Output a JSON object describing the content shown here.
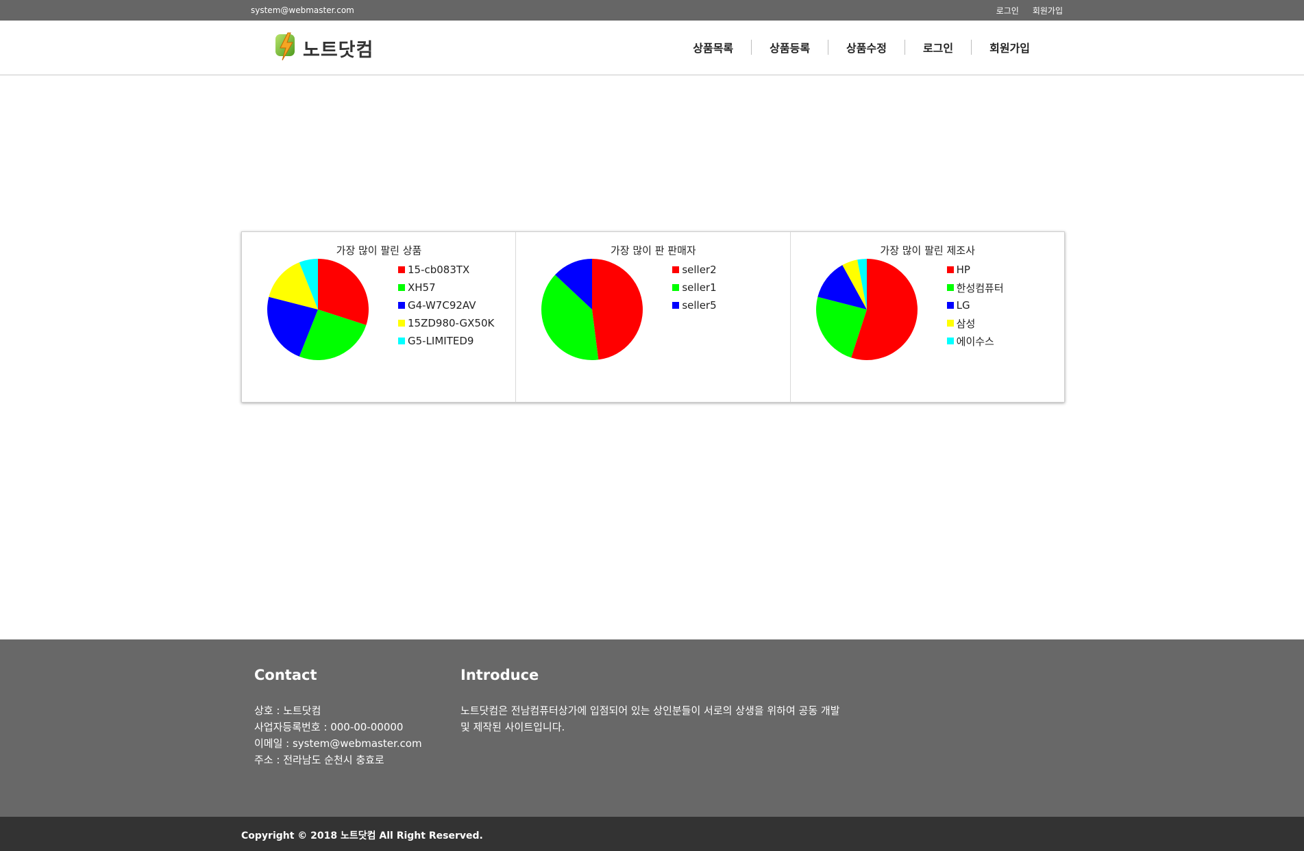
{
  "topbar": {
    "email": "system@webmaster.com",
    "login_label": "로그인",
    "signup_label": "회원가입"
  },
  "header": {
    "logo_text": "노트닷컴",
    "nav": [
      {
        "label": "상품목록"
      },
      {
        "label": "상품등록"
      },
      {
        "label": "상품수정"
      },
      {
        "label": "로그인"
      },
      {
        "label": "회원가입"
      }
    ]
  },
  "chart_data": [
    {
      "type": "pie",
      "title": "가장 많이 팔린 상품",
      "slices": [
        {
          "label": "15-cb083TX",
          "value": 30,
          "color": "#ff0000"
        },
        {
          "label": "XH57",
          "value": 26,
          "color": "#00ff00"
        },
        {
          "label": "G4-W7C92AV",
          "value": 23,
          "color": "#0000ff"
        },
        {
          "label": "15ZD980-GX50K",
          "value": 15,
          "color": "#ffff00"
        },
        {
          "label": "G5-LIMITED9",
          "value": 6,
          "color": "#00ffff"
        }
      ]
    },
    {
      "type": "pie",
      "title": "가장 많이 판 판매자",
      "slices": [
        {
          "label": "seller2",
          "value": 48,
          "color": "#ff0000"
        },
        {
          "label": "seller1",
          "value": 39,
          "color": "#00ff00"
        },
        {
          "label": "seller5",
          "value": 13,
          "color": "#0000ff"
        }
      ]
    },
    {
      "type": "pie",
      "title": "가장 많이 팔린 제조사",
      "slices": [
        {
          "label": "HP",
          "value": 55,
          "color": "#ff0000"
        },
        {
          "label": "한성컴퓨터",
          "value": 24,
          "color": "#00ff00"
        },
        {
          "label": "LG",
          "value": 13,
          "color": "#0000ff"
        },
        {
          "label": "삼성",
          "value": 5,
          "color": "#ffff00"
        },
        {
          "label": "에이수스",
          "value": 3,
          "color": "#00ffff"
        }
      ]
    }
  ],
  "footer": {
    "contact_heading": "Contact",
    "contact_lines": [
      "상호 : 노트닷컴",
      "사업자등록번호 : 000-00-00000",
      "이메일 : system@webmaster.com",
      "주소 : 전라남도 순천시 충효로"
    ],
    "introduce_heading": "Introduce",
    "introduce_text": "노트닷컴은 전남컴퓨터상가에 입점되어 있는 상인분들이 서로의 상생을 위하여 공동 개발 및 제작된 사이트입니다.",
    "copyright": "Copyright © 2018 노트닷컴 All Right Reserved."
  }
}
